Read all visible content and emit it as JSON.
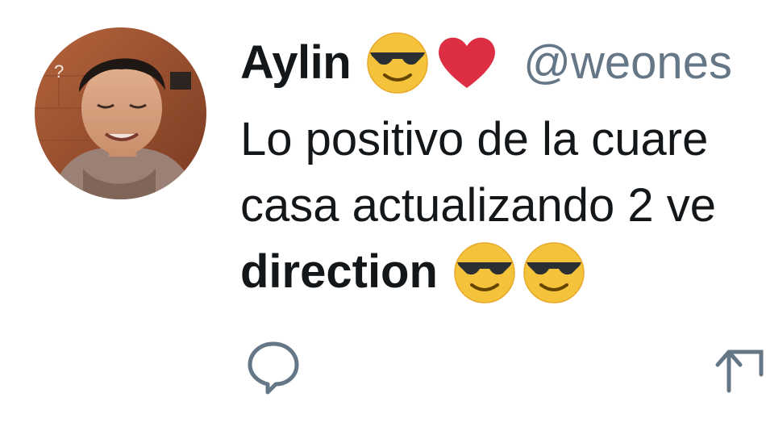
{
  "tweet": {
    "display_name": "Aylin",
    "name_emojis": [
      "sunglasses-emoji",
      "red-heart-emoji"
    ],
    "handle": "@weones",
    "text_lines": [
      "Lo positivo de la cuare",
      "casa actualizando 2 ve"
    ],
    "bold_text": "direction",
    "trailing_emojis": [
      "sunglasses-emoji",
      "sunglasses-emoji"
    ]
  },
  "actions": {
    "icons": [
      "reply-icon",
      "retweet-icon"
    ]
  },
  "colors": {
    "text": "#14171a",
    "handle": "#657786",
    "icon": "#657786",
    "heart": "#e0245e",
    "emoji_face": "#f5c33b"
  }
}
